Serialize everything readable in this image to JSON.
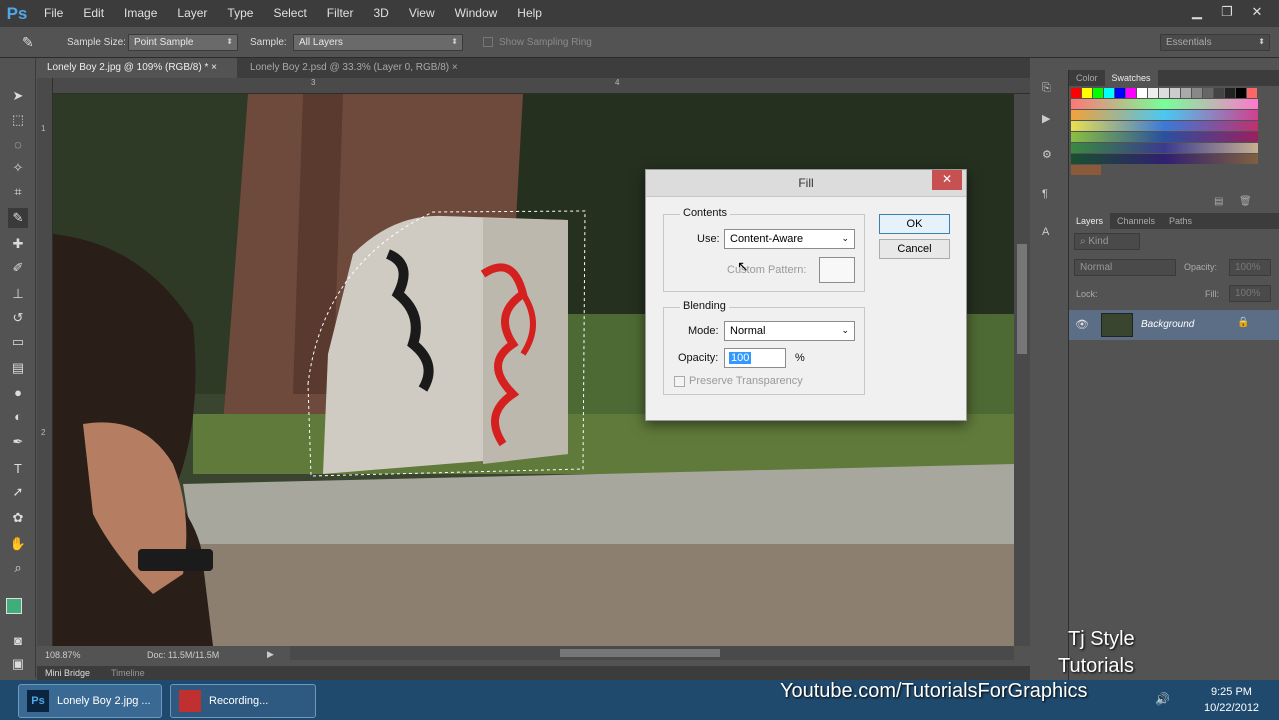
{
  "app": {
    "logo": "Ps"
  },
  "menu": [
    "File",
    "Edit",
    "Image",
    "Layer",
    "Type",
    "Select",
    "Filter",
    "3D",
    "View",
    "Window",
    "Help"
  ],
  "options": {
    "sample_size_label": "Sample Size:",
    "sample_size_value": "Point Sample",
    "sample_label": "Sample:",
    "sample_value": "All Layers",
    "show_ring_label": "Show Sampling Ring",
    "workspace": "Essentials"
  },
  "tabs": [
    {
      "label": "Lonely Boy 2.jpg @ 109% (RGB/8) *"
    },
    {
      "label": "Lonely Boy 2.psd @ 33.3% (Layer 0, RGB/8)"
    }
  ],
  "ruler": {
    "top_marks": [
      "3",
      "4"
    ],
    "left_marks": [
      "1",
      "2"
    ]
  },
  "status": {
    "zoom": "108.87%",
    "doc": "Doc: 11.5M/11.5M"
  },
  "bottom_tabs": [
    "Mini Bridge",
    "Timeline"
  ],
  "panels": {
    "color_tabs": [
      "Color",
      "Swatches"
    ],
    "layer_tabs": [
      "Layers",
      "Channels",
      "Paths"
    ],
    "kind_label": "Kind",
    "blend_mode": "Normal",
    "opacity_label": "Opacity:",
    "opacity_value": "100%",
    "lock_label": "Lock:",
    "fill_label": "Fill:",
    "fill_value": "100%",
    "layer_name": "Background"
  },
  "dialog": {
    "title": "Fill",
    "contents_legend": "Contents",
    "use_label": "Use:",
    "use_value": "Content-Aware",
    "custom_pattern_label": "Custom Pattern:",
    "blending_legend": "Blending",
    "mode_label": "Mode:",
    "mode_value": "Normal",
    "opacity_label": "Opacity:",
    "opacity_value": "100",
    "opacity_unit": "%",
    "preserve_label": "Preserve Transparency",
    "ok": "OK",
    "cancel": "Cancel"
  },
  "taskbar": {
    "items": [
      "Lonely Boy 2.jpg ...",
      "Recording..."
    ],
    "time": "9:25 PM",
    "date": "10/22/2012"
  },
  "watermark": {
    "line1": "Tj Style",
    "line2": "Tutorials",
    "url": "Youtube.com/TutorialsForGraphics"
  }
}
